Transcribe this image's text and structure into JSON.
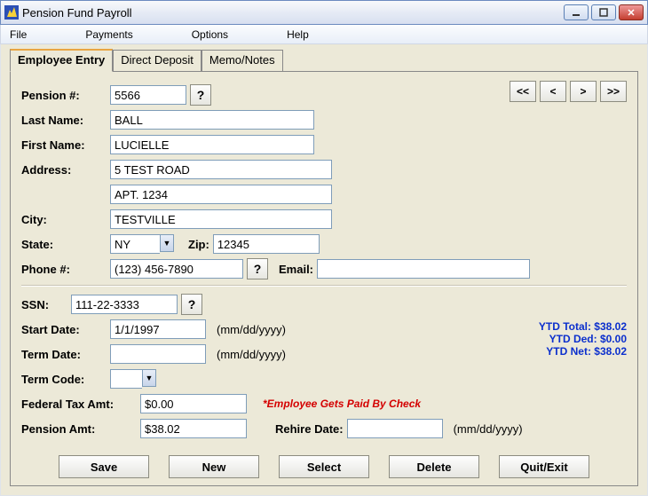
{
  "window": {
    "title": "Pension Fund Payroll"
  },
  "menu": {
    "file": "File",
    "payments": "Payments",
    "options": "Options",
    "help": "Help"
  },
  "tabs": {
    "employee": "Employee Entry",
    "deposit": "Direct Deposit",
    "memo": "Memo/Notes"
  },
  "nav": {
    "first": "<<",
    "prev": "<",
    "next": ">",
    "last": ">>"
  },
  "labels": {
    "pension_num": "Pension #:",
    "last_name": "Last Name:",
    "first_name": "First Name:",
    "address": "Address:",
    "city": "City:",
    "state": "State:",
    "zip": "Zip:",
    "phone": "Phone #:",
    "email": "Email:",
    "ssn": "SSN:",
    "start_date": "Start Date:",
    "term_date": "Term Date:",
    "term_code": "Term Code:",
    "fed_tax": "Federal Tax Amt:",
    "pension_amt": "Pension Amt:",
    "rehire_date": "Rehire Date:"
  },
  "values": {
    "pension_num": "5566",
    "last_name": "BALL",
    "first_name": "LUCIELLE",
    "address1": "5 TEST ROAD",
    "address2": "APT. 1234",
    "city": "TESTVILLE",
    "state": "NY",
    "zip": "12345",
    "phone": "(123) 456-7890",
    "email": "",
    "ssn": "111-22-3333",
    "start_date": "1/1/1997",
    "term_date": "",
    "term_code": "",
    "fed_tax": "$0.00",
    "pension_amt": "$38.02",
    "rehire_date": ""
  },
  "hints": {
    "qmark": "?",
    "date_fmt": "(mm/dd/yyyy)",
    "paid_by_check": "*Employee Gets Paid By Check"
  },
  "ytd": {
    "total": "YTD Total: $38.02",
    "ded": "YTD Ded: $0.00",
    "net": "YTD Net: $38.02"
  },
  "buttons": {
    "save": "Save",
    "new": "New",
    "select": "Select",
    "delete": "Delete",
    "quit": "Quit/Exit"
  }
}
